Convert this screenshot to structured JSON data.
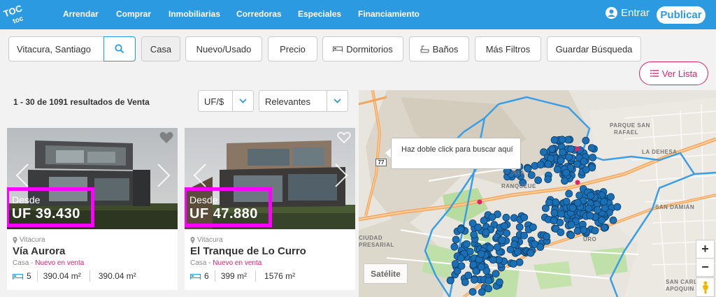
{
  "nav": {
    "items": [
      "Arrendar",
      "Comprar",
      "Inmobiliarias",
      "Corredoras",
      "Especiales",
      "Financiamiento"
    ],
    "login_label": "Entrar",
    "publish_label": "Publicar"
  },
  "filters": {
    "search_value": "Vitacura, Santiago",
    "property_type": "Casa",
    "condition": "Nuevo/Usado",
    "price": "Precio",
    "bedrooms": "Dormitorios",
    "bathrooms": "Baños",
    "more_filters": "Más Filtros",
    "save_search": "Guardar Búsqueda",
    "list_view": "Ver Lista"
  },
  "results": {
    "summary": "1 - 30 de 1091 resultados de Venta",
    "currency": "UF/$",
    "sort": "Relevantes"
  },
  "listings": [
    {
      "price_label": "Desde",
      "price": "UF 39.430",
      "location": "Vitacura",
      "title": "Vía Aurora",
      "type": "Casa",
      "status": "Nuevo en venta",
      "bedrooms": "5",
      "built_area": "390.04 m²",
      "total_area": "390.04 m²"
    },
    {
      "price_label": "Desde",
      "price": "UF 47.880",
      "location": "Vitacura",
      "title": "El Tranque de Lo Curro",
      "type": "Casa",
      "status": "Nuevo en venta",
      "bedrooms": "6",
      "built_area": "399 m²",
      "total_area": "1576 m²"
    }
  ],
  "map": {
    "tooltip": "Haz doble click para buscar aquí",
    "satellite_label": "Satélite",
    "zoom_in": "+",
    "zoom_out": "−",
    "route_shield": "77",
    "labels": [
      "PARQUE SAN",
      "RAFAEL",
      "LA DEHESA",
      "SAN DAMIÁN",
      "CIUDAD",
      "PRESARIAL",
      "SAN CARLO",
      "APOQUIN",
      "NTA",
      "RANQUEUE",
      "URO"
    ],
    "marker_color": "#1a6fb5",
    "boundary_color": "#3a9ee4",
    "highlight_color": "#e0226b"
  },
  "colors": {
    "brand": "#2c9ae0",
    "accent": "#e0226b",
    "price_highlight": "#ff00ff"
  }
}
